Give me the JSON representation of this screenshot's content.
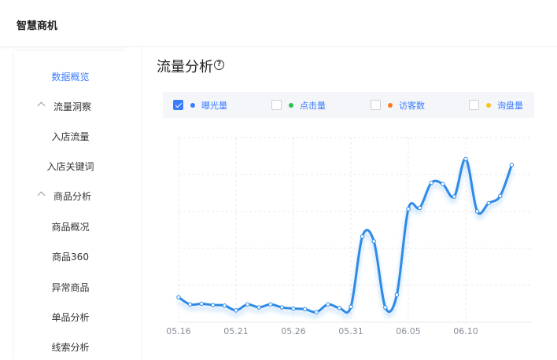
{
  "header": {
    "brand": "智慧商机"
  },
  "sidebar": {
    "items": [
      {
        "label": "数据概览",
        "type": "link",
        "active": true
      },
      {
        "label": "流量洞察",
        "type": "group"
      },
      {
        "label": "入店流量",
        "type": "link"
      },
      {
        "label": "入店关键词",
        "type": "link"
      },
      {
        "label": "商品分析",
        "type": "group"
      },
      {
        "label": "商品概况",
        "type": "link"
      },
      {
        "label": "商品360",
        "type": "link"
      },
      {
        "label": "异常商品",
        "type": "link"
      },
      {
        "label": "单品分析",
        "type": "link"
      },
      {
        "label": "线索分析",
        "type": "link"
      }
    ]
  },
  "main": {
    "title": "流量分析",
    "help_icon": "?",
    "legend": [
      {
        "label": "曝光量",
        "color": "#3a7bff",
        "checked": true
      },
      {
        "label": "点击量",
        "color": "#2fbf53",
        "checked": false
      },
      {
        "label": "访客数",
        "color": "#ff7a1a",
        "checked": false
      },
      {
        "label": "询盘量",
        "color": "#f5c518",
        "checked": false
      }
    ]
  },
  "chart_data": {
    "type": "line",
    "title": "",
    "xlabel": "",
    "ylabel": "",
    "x_tick_labels": [
      "05.16",
      "05.21",
      "05.26",
      "05.31",
      "06.05",
      "06.10"
    ],
    "series": [
      {
        "color": "#2f8ae6",
        "points": [
          [
            "05.16",
            42
          ],
          [
            "05.17",
            30
          ],
          [
            "05.18",
            31
          ],
          [
            "05.19",
            29
          ],
          [
            "05.20",
            28
          ],
          [
            "05.21",
            20
          ],
          [
            "05.22",
            30
          ],
          [
            "05.23",
            25
          ],
          [
            "05.24",
            30
          ],
          [
            "05.25",
            25
          ],
          [
            "05.26",
            23
          ],
          [
            "05.27",
            22
          ],
          [
            "05.28",
            17
          ],
          [
            "05.29",
            30
          ],
          [
            "05.30",
            24
          ],
          [
            "05.31",
            26
          ],
          [
            "06.01",
            144
          ],
          [
            "06.02",
            136
          ],
          [
            "06.03",
            25
          ],
          [
            "06.04",
            46
          ],
          [
            "06.05",
            190
          ],
          [
            "06.06",
            192
          ],
          [
            "06.07",
            234
          ],
          [
            "06.08",
            232
          ],
          [
            "06.09",
            211
          ],
          [
            "06.10",
            274
          ],
          [
            "06.11",
            186
          ],
          [
            "06.12",
            200
          ],
          [
            "06.13",
            212
          ],
          [
            "06.14",
            264
          ]
        ]
      }
    ],
    "ylim": [
      0,
      310
    ],
    "grid": true
  }
}
